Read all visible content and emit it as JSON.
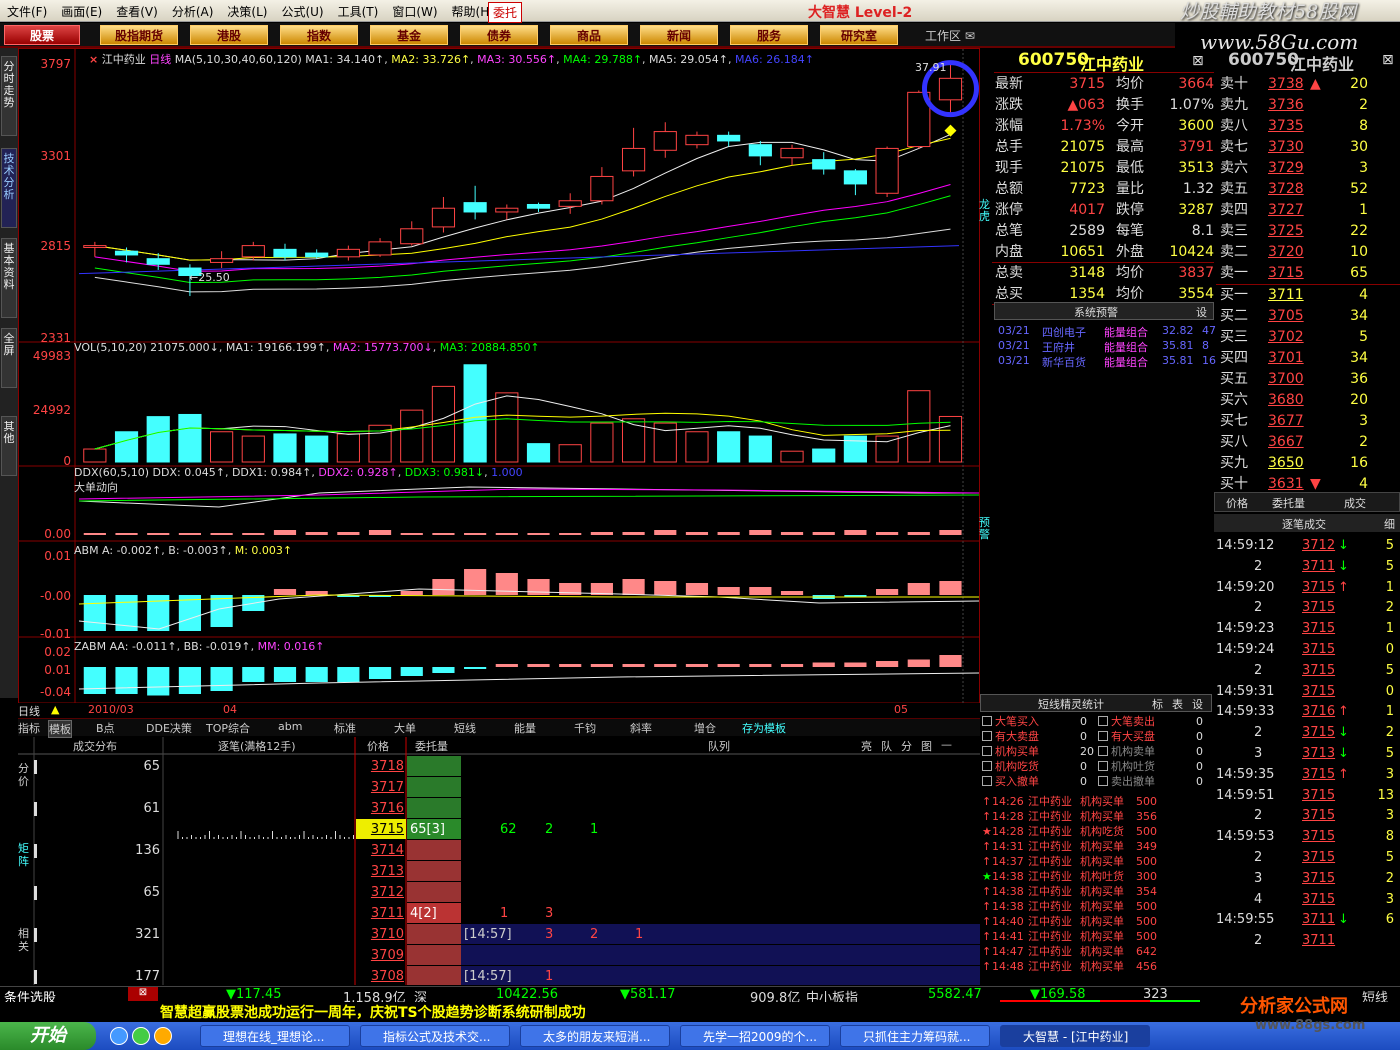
{
  "menu": [
    "文件(F)",
    "画面(E)",
    "查看(V)",
    "分析(A)",
    "决策(L)",
    "公式(U)",
    "工具(T)",
    "窗口(W)",
    "帮助(H)"
  ],
  "menu_entrust": "委托",
  "logo": "大智慧 Level-2",
  "watermark": "炒股輔助教材58股网",
  "watermark_url": "www.58Gu.com",
  "toolbar": [
    "股票",
    "股指期货",
    "港股",
    "指数",
    "基金",
    "债券",
    "商品",
    "新闻",
    "服务",
    "研究室"
  ],
  "workarea": "工作区",
  "vtabs": [
    "分时走势",
    "技术分析",
    "基本资料",
    "全屏",
    "其他"
  ],
  "chart_header": {
    "stock": "江中药业",
    "period": "日线",
    "ma_label": "MA(5,10,30,40,60,120)",
    "ma1": "MA1: 34.140↑",
    "ma2": "MA2: 33.726↑",
    "ma3": "MA3: 30.556↑",
    "ma4": "MA4: 29.788↑",
    "ma5": "MA5: 29.054↑",
    "ma6": "MA6: 26.184↑"
  },
  "price_axis": [
    "3797",
    "3301",
    "2815",
    "2331"
  ],
  "price_notes": {
    "low": "←25.50",
    "high": "37.91"
  },
  "vol_header": {
    "label": "VOL(5,10,20) 21075.000↓",
    "ma1": "MA1: 19166.199↑",
    "ma2": "MA2: 15773.700↓",
    "ma3": "MA3: 20884.850↑"
  },
  "vol_axis": [
    "49983",
    "24992",
    "0"
  ],
  "ddx_header": {
    "label": "DDX(60,5,10) DDX: 0.045↑",
    "ddx1": "DDX1: 0.984↑",
    "ddx2": "DDX2: 0.928↑",
    "ddx3": "DDX3: 0.981↓",
    "tail": "1.000"
  },
  "ddx_sub": "大单动向",
  "ddx_axis": [
    "0.00"
  ],
  "abm_header": {
    "label": "ABM A: -0.002↑",
    "b": "B: -0.003↑",
    "m": "M: 0.003↑"
  },
  "abm_axis": [
    "0.01",
    "-0.00",
    "-0.01"
  ],
  "zabm_header": {
    "label": "ZABM AA: -0.011↑",
    "bb": "BB: -0.019↑",
    "mm": "MM: 0.016↑"
  },
  "zabm_axis": [
    "0.02",
    "0.01",
    "-0.04"
  ],
  "date_axis": {
    "period": "日线",
    "d1": "2010/03",
    "d2": "04",
    "d3": "05"
  },
  "side_labels": {
    "longhu": "龙虎",
    "yujing": "预警"
  },
  "quote_code": "600750",
  "quote_name": "江中药业",
  "quote": [
    {
      "l": "最新",
      "v": "3715",
      "l2": "均价",
      "v2": "3664",
      "c": "red",
      "c2": "red"
    },
    {
      "l": "涨跌",
      "v": "▲063",
      "l2": "换手",
      "v2": "1.07%",
      "c": "red",
      "c2": "wht"
    },
    {
      "l": "涨幅",
      "v": "1.73%",
      "l2": "今开",
      "v2": "3600",
      "c": "red",
      "c2": "ylw"
    },
    {
      "l": "总手",
      "v": "21075",
      "l2": "最高",
      "v2": "3791",
      "c": "ylw",
      "c2": "red"
    },
    {
      "l": "现手",
      "v": "21075",
      "l2": "最低",
      "v2": "3513",
      "c": "ylw",
      "c2": "ylw"
    },
    {
      "l": "总额",
      "v": "7723",
      "l2": "量比",
      "v2": "1.32",
      "c": "ylw",
      "c2": "wht"
    },
    {
      "l": "涨停",
      "v": "4017",
      "l2": "跌停",
      "v2": "3287",
      "c": "red",
      "c2": "ylw"
    },
    {
      "l": "总笔",
      "v": "2589",
      "l2": "每笔",
      "v2": "8.1",
      "c": "wht",
      "c2": "wht"
    },
    {
      "l": "内盘",
      "v": "10651",
      "l2": "外盘",
      "v2": "10424",
      "c": "ylw",
      "c2": "ylw"
    },
    {
      "l": "总卖",
      "v": "3148",
      "l2": "均价",
      "v2": "3837",
      "c": "ylw",
      "c2": "red"
    },
    {
      "l": "总买",
      "v": "1354",
      "l2": "均价",
      "v2": "3554",
      "c": "ylw",
      "c2": "ylw"
    }
  ],
  "sys_alert": {
    "title": "系统预警",
    "set": "设",
    "rows": [
      {
        "d": "03/21",
        "n": "四创电子",
        "t": "能量组合",
        "p": "32.82",
        "x": "47"
      },
      {
        "d": "03/21",
        "n": "王府井",
        "t": "能量组合",
        "p": "35.81",
        "x": "8"
      },
      {
        "d": "03/21",
        "n": "新华百货",
        "t": "能量组合",
        "p": "35.81",
        "x": "16"
      }
    ]
  },
  "orderbook": {
    "sells": [
      {
        "l": "卖十",
        "p": "3738",
        "q": "20"
      },
      {
        "l": "卖九",
        "p": "3736",
        "q": "2"
      },
      {
        "l": "卖八",
        "p": "3735",
        "q": "8"
      },
      {
        "l": "卖七",
        "p": "3730",
        "q": "30"
      },
      {
        "l": "卖六",
        "p": "3729",
        "q": "3"
      },
      {
        "l": "卖五",
        "p": "3728",
        "q": "52"
      },
      {
        "l": "卖四",
        "p": "3727",
        "q": "1"
      },
      {
        "l": "卖三",
        "p": "3725",
        "q": "22"
      },
      {
        "l": "卖二",
        "p": "3720",
        "q": "10"
      },
      {
        "l": "卖一",
        "p": "3715",
        "q": "65"
      }
    ],
    "buys": [
      {
        "l": "买一",
        "p": "3711",
        "q": "4"
      },
      {
        "l": "买二",
        "p": "3705",
        "q": "34"
      },
      {
        "l": "买三",
        "p": "3702",
        "q": "5"
      },
      {
        "l": "买四",
        "p": "3701",
        "q": "34"
      },
      {
        "l": "买五",
        "p": "3700",
        "q": "36"
      },
      {
        "l": "买六",
        "p": "3680",
        "q": "20"
      },
      {
        "l": "买七",
        "p": "3677",
        "q": "3"
      },
      {
        "l": "买八",
        "p": "3667",
        "q": "2"
      },
      {
        "l": "买九",
        "p": "3650",
        "q": "16"
      },
      {
        "l": "买十",
        "p": "3631",
        "q": "4"
      }
    ],
    "tabs": [
      "价格",
      "委托量",
      "成交"
    ],
    "ticks_title": "逐笔成交",
    "ticks_fine": "细"
  },
  "ticks": [
    {
      "t": "14:59:12",
      "p": "3712",
      "v": "5",
      "d": "down"
    },
    {
      "t": "2",
      "p": "3711",
      "v": "5",
      "d": "down"
    },
    {
      "t": "14:59:20",
      "p": "3715",
      "v": "1",
      "d": "up"
    },
    {
      "t": "2",
      "p": "3715",
      "v": "2",
      "d": ""
    },
    {
      "t": "14:59:23",
      "p": "3715",
      "v": "1",
      "d": ""
    },
    {
      "t": "14:59:24",
      "p": "3715",
      "v": "0",
      "d": ""
    },
    {
      "t": "2",
      "p": "3715",
      "v": "5",
      "d": ""
    },
    {
      "t": "14:59:31",
      "p": "3715",
      "v": "0",
      "d": ""
    },
    {
      "t": "14:59:33",
      "p": "3716",
      "v": "1",
      "d": "up"
    },
    {
      "t": "2",
      "p": "3715",
      "v": "2",
      "d": "down"
    },
    {
      "t": "3",
      "p": "3713",
      "v": "5",
      "d": "down"
    },
    {
      "t": "14:59:35",
      "p": "3715",
      "v": "3",
      "d": "up"
    },
    {
      "t": "14:59:51",
      "p": "3715",
      "v": "13",
      "d": ""
    },
    {
      "t": "2",
      "p": "3715",
      "v": "3",
      "d": ""
    },
    {
      "t": "14:59:53",
      "p": "3715",
      "v": "8",
      "d": ""
    },
    {
      "t": "2",
      "p": "3715",
      "v": "5",
      "d": ""
    },
    {
      "t": "3",
      "p": "3715",
      "v": "2",
      "d": ""
    },
    {
      "t": "4",
      "p": "3715",
      "v": "3",
      "d": ""
    },
    {
      "t": "14:59:55",
      "p": "3711",
      "v": "6",
      "d": "down"
    },
    {
      "t": "2",
      "p": "3711",
      "v": "",
      "d": ""
    }
  ],
  "short_wizard": {
    "title": "短线精灵统计",
    "tabs": [
      "标",
      "表",
      "设"
    ],
    "left": [
      {
        "l": "大笔买入",
        "v": "0"
      },
      {
        "l": "有大卖盘",
        "v": "0"
      },
      {
        "l": "机构买单",
        "v": "20"
      },
      {
        "l": "机构吃货",
        "v": "0"
      },
      {
        "l": "买入撤单",
        "v": "0"
      }
    ],
    "right": [
      {
        "l": "大笔卖出",
        "v": "0"
      },
      {
        "l": "有大买盘",
        "v": "0"
      },
      {
        "l": "机构卖单",
        "v": "0"
      },
      {
        "l": "机构吐货",
        "v": "0"
      },
      {
        "l": "卖出撤单",
        "v": "0"
      }
    ],
    "log": [
      {
        "t": "14:26",
        "n": "江中药业",
        "e": "机构买单",
        "v": "500"
      },
      {
        "t": "14:28",
        "n": "江中药业",
        "e": "机构买单",
        "v": "356"
      },
      {
        "t": "14:28",
        "n": "江中药业",
        "e": "机构吃货",
        "v": "500"
      },
      {
        "t": "14:31",
        "n": "江中药业",
        "e": "机构买单",
        "v": "349"
      },
      {
        "t": "14:37",
        "n": "江中药业",
        "e": "机构买单",
        "v": "500"
      },
      {
        "t": "14:38",
        "n": "江中药业",
        "e": "机构吐货",
        "v": "300"
      },
      {
        "t": "14:38",
        "n": "江中药业",
        "e": "机构买单",
        "v": "354"
      },
      {
        "t": "14:38",
        "n": "江中药业",
        "e": "机构买单",
        "v": "500"
      },
      {
        "t": "14:40",
        "n": "江中药业",
        "e": "机构买单",
        "v": "500"
      },
      {
        "t": "14:41",
        "n": "江中药业",
        "e": "机构买单",
        "v": "500"
      },
      {
        "t": "14:47",
        "n": "江中药业",
        "e": "机构买单",
        "v": "642"
      },
      {
        "t": "14:48",
        "n": "江中药业",
        "e": "机构买单",
        "v": "456"
      }
    ]
  },
  "bottom_tabs": [
    "指标",
    "模板",
    "B点",
    "DDE决策",
    "TOP综合",
    "abm",
    "标准",
    "大单",
    "短线",
    "能量",
    "千钧",
    "斜率",
    "增仓",
    "存为模板"
  ],
  "ladder": {
    "headers": [
      "成交分布",
      "逐笔(满格12手)",
      "价格",
      "委托量",
      "队列"
    ],
    "tools": [
      "亮",
      "队",
      "分",
      "图",
      "—"
    ],
    "left_labels": [
      "分价",
      "矩阵",
      "相关"
    ],
    "rows": [
      {
        "dist": "65",
        "price": "3718",
        "q": "",
        "queue": [
          "",
          "",
          "",
          ""
        ]
      },
      {
        "dist": "",
        "price": "3717",
        "q": "",
        "queue": [
          "",
          "",
          "",
          ""
        ]
      },
      {
        "dist": "61",
        "price": "3716",
        "q": "",
        "queue": [
          "",
          "",
          "",
          ""
        ]
      },
      {
        "dist": "",
        "price": "3715",
        "q": "65[3]",
        "queue": [
          "62",
          "2",
          "1",
          ""
        ]
      },
      {
        "dist": "136",
        "price": "3714",
        "q": "",
        "queue": [
          "",
          "",
          "",
          ""
        ]
      },
      {
        "dist": "",
        "price": "3713",
        "q": "",
        "queue": [
          "",
          "",
          "",
          ""
        ]
      },
      {
        "dist": "65",
        "price": "3712",
        "q": "",
        "queue": [
          "",
          "",
          "",
          ""
        ]
      },
      {
        "dist": "",
        "price": "3711",
        "q": "4[2]",
        "queue": [
          "1",
          "3",
          "",
          ""
        ]
      },
      {
        "dist": "321",
        "price": "3710",
        "q": "",
        "queue": [
          "[14:57]",
          "3",
          "2",
          "1"
        ]
      },
      {
        "dist": "",
        "price": "3709",
        "q": "",
        "queue": [
          "",
          "",
          "",
          ""
        ]
      },
      {
        "dist": "177",
        "price": "3708",
        "q": "",
        "queue": [
          "[14:57]",
          "1",
          "",
          ""
        ]
      }
    ]
  },
  "statusbar": {
    "left": "条件选股",
    "sh_chg": "▼117.45",
    "sh_amt": "1,158.9亿",
    "sz_label": "深",
    "sz_idx": "10422.56",
    "sz_chg": "▼581.17",
    "sz_amt": "909.8亿",
    "sme_label": "中小板指",
    "sme_idx": "5582.47",
    "sme_chg": "▼169.58",
    "sme_more": "323",
    "short": "短线"
  },
  "scroller": "智慧超赢股票池成功运行一周年，庆祝TS个股趋势诊断系统研制成功",
  "taskbar": {
    "start": "开始",
    "tasks": [
      "理想在线_理想论...",
      "指标公式及技术交...",
      "太多的朋友来短消...",
      "先学一招2009的个...",
      "只抓住主力筹码就...",
      "大智慧 - [江中药业]"
    ]
  },
  "brand2": "分析家公式网",
  "brand2_url": "www.88gs.com",
  "chart_data": {
    "type": "candlestick",
    "title": "江中药业 日线",
    "ylim": [
      23.31,
      37.97
    ],
    "candles": [
      {
        "o": 28.1,
        "c": 28.2,
        "h": 28.4,
        "l": 27.6
      },
      {
        "o": 27.9,
        "c": 27.7,
        "h": 28.1,
        "l": 27.3
      },
      {
        "o": 27.5,
        "c": 27.2,
        "h": 27.8,
        "l": 26.9
      },
      {
        "o": 27.0,
        "c": 26.6,
        "h": 27.2,
        "l": 25.5
      },
      {
        "o": 27.3,
        "c": 27.5,
        "h": 27.9,
        "l": 27.0
      },
      {
        "o": 27.6,
        "c": 28.2,
        "h": 28.4,
        "l": 27.4
      },
      {
        "o": 28.0,
        "c": 27.6,
        "h": 28.3,
        "l": 27.4
      },
      {
        "o": 27.8,
        "c": 27.6,
        "h": 28.0,
        "l": 27.5
      },
      {
        "o": 27.6,
        "c": 28.0,
        "h": 28.2,
        "l": 27.4
      },
      {
        "o": 27.7,
        "c": 28.4,
        "h": 28.6,
        "l": 27.6
      },
      {
        "o": 28.3,
        "c": 29.1,
        "h": 29.5,
        "l": 28.2
      },
      {
        "o": 29.2,
        "c": 30.2,
        "h": 30.8,
        "l": 28.9
      },
      {
        "o": 30.5,
        "c": 30.0,
        "h": 31.4,
        "l": 29.6
      },
      {
        "o": 30.0,
        "c": 30.2,
        "h": 30.4,
        "l": 29.6
      },
      {
        "o": 30.4,
        "c": 30.2,
        "h": 30.5,
        "l": 30.0
      },
      {
        "o": 30.3,
        "c": 30.6,
        "h": 31.0,
        "l": 29.9
      },
      {
        "o": 30.6,
        "c": 31.9,
        "h": 32.4,
        "l": 30.4
      },
      {
        "o": 32.2,
        "c": 33.4,
        "h": 34.5,
        "l": 31.9
      },
      {
        "o": 33.3,
        "c": 34.3,
        "h": 34.8,
        "l": 32.9
      },
      {
        "o": 33.6,
        "c": 34.1,
        "h": 34.3,
        "l": 33.4
      },
      {
        "o": 34.1,
        "c": 33.8,
        "h": 34.3,
        "l": 33.5
      },
      {
        "o": 33.6,
        "c": 33.0,
        "h": 33.8,
        "l": 32.5
      },
      {
        "o": 32.9,
        "c": 33.4,
        "h": 33.6,
        "l": 32.5
      },
      {
        "o": 32.8,
        "c": 32.3,
        "h": 33.2,
        "l": 32.0
      },
      {
        "o": 32.2,
        "c": 31.5,
        "h": 32.3,
        "l": 30.9
      },
      {
        "o": 31.0,
        "c": 33.4,
        "h": 33.5,
        "l": 30.8
      },
      {
        "o": 33.5,
        "c": 36.4,
        "h": 36.5,
        "l": 33.4
      },
      {
        "o": 36.0,
        "c": 37.15,
        "h": 37.91,
        "l": 35.13
      }
    ],
    "volumes": [
      6000,
      14000,
      21000,
      22000,
      14000,
      12000,
      13000,
      12000,
      13000,
      17000,
      24000,
      35000,
      45000,
      32000,
      8500,
      8000,
      18000,
      20000,
      18000,
      14000,
      14000,
      12000,
      5000,
      6000,
      12000,
      12000,
      33000,
      21075
    ]
  }
}
